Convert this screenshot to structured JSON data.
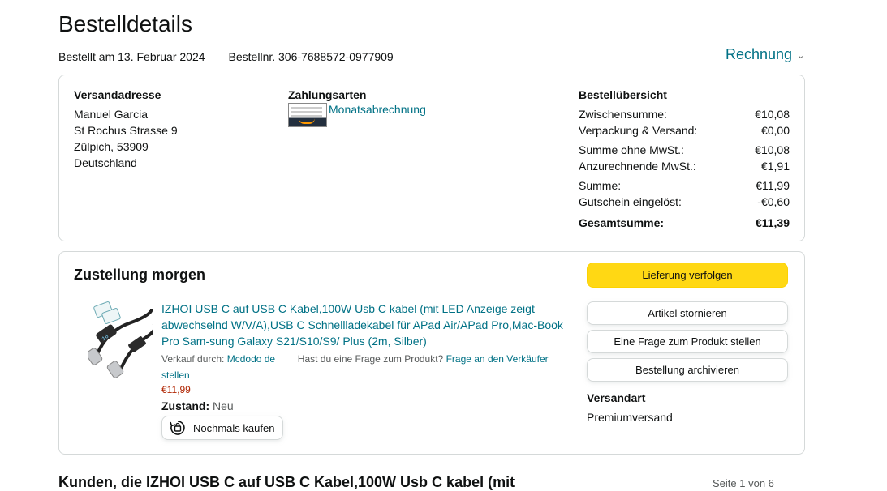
{
  "page": {
    "title": "Bestelldetails",
    "order_date": "Bestellt am 13. Februar 2024",
    "order_number": "Bestellnr. 306-7688572-0977909",
    "invoice_label": "Rechnung"
  },
  "address": {
    "heading": "Versandadresse",
    "lines": [
      "Manuel Garcia",
      "St Rochus Strasse 9",
      "Zülpich, 53909",
      "Deutschland"
    ]
  },
  "payment": {
    "heading": "Zahlungsarten",
    "method": "Monatsabrechnung"
  },
  "summary": {
    "heading": "Bestellübersicht",
    "rows": [
      {
        "label": "Zwischensumme:",
        "value": "€10,08"
      },
      {
        "label": "Verpackung & Versand:",
        "value": "€0,00"
      },
      {
        "label": "Summe ohne MwSt.:",
        "value": "€10,08"
      },
      {
        "label": "Anzurechnende MwSt.:",
        "value": "€1,91"
      },
      {
        "label": "Summe:",
        "value": "€11,99"
      },
      {
        "label": "Gutschein eingelöst:",
        "value": "-€0,60"
      }
    ],
    "total_label": "Gesamtsumme:",
    "total_value": "€11,39"
  },
  "delivery": {
    "heading": "Zustellung morgen",
    "product_title": "IZHOI USB C auf USB C Kabel,100W Usb C kabel (mit LED Anzeige zeigt abwechselnd W/V/A),USB C Schnellladekabel für APad Air/APad Pro,Mac-Book Pro Sam-sung Galaxy S21/S10/S9/ Plus (2m, Silber)",
    "sold_by_label": "Verkauf durch:",
    "seller": "Mcdodo de",
    "question_label": "Hast du eine Frage zum Produkt?",
    "question_link": "Frage an den Verkäufer stellen",
    "price": "€11,99",
    "condition_label": "Zustand:",
    "condition_value": "Neu",
    "buy_again": "Nochmals kaufen",
    "image_display": "16",
    "buttons": {
      "track": "Lieferung verfolgen",
      "cancel": "Artikel stornieren",
      "question": "Eine Frage zum Produkt stellen",
      "archive": "Bestellung archivieren"
    },
    "shipping_heading": "Versandart",
    "shipping_value": "Premiumversand"
  },
  "bottom": {
    "title": "Kunden, die IZHOI USB C auf USB C Kabel,100W Usb C kabel (mit",
    "pager": "Seite 1 von 6"
  },
  "colors": {
    "link": "#007185",
    "primary_button": "#ffd814",
    "price": "#b12704",
    "border": "#d5d9d9"
  }
}
